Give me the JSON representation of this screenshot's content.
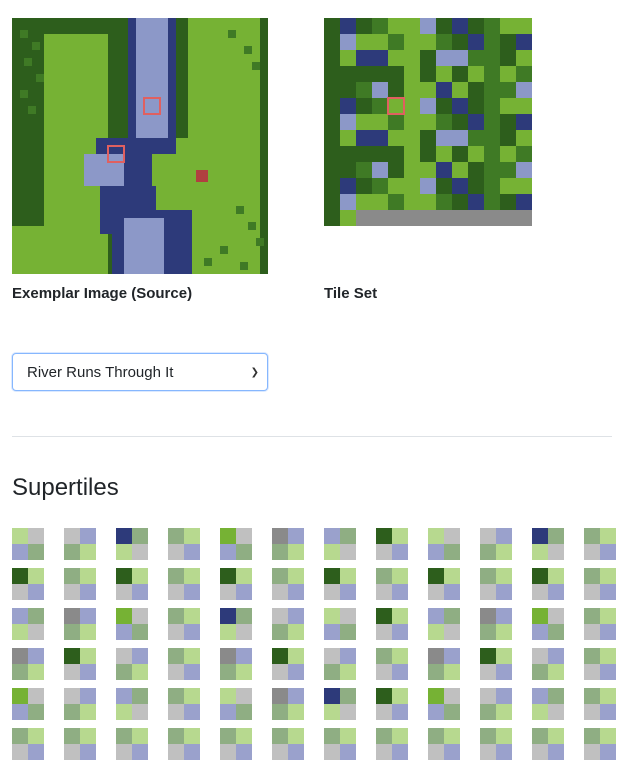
{
  "captions": {
    "exemplar": "Exemplar Image (Source)",
    "tileset": "Tile Set"
  },
  "preset_select": {
    "selected": "River Runs Through It"
  },
  "supertiles": {
    "heading": "Supertiles"
  },
  "colors": {
    "grass": "#76b234",
    "dark_green": "#2d5e1c",
    "forest": "#3f7a25",
    "river": "#2d3a7a",
    "river_light": "#8c98c8",
    "gray": "#8a8a8a",
    "light_gray": "#c0c0c0",
    "fade_grass": "#b7d98f",
    "fade_dark": "#8fae83",
    "fade_river": "#9aa1cc",
    "highlight": "#e06060"
  }
}
